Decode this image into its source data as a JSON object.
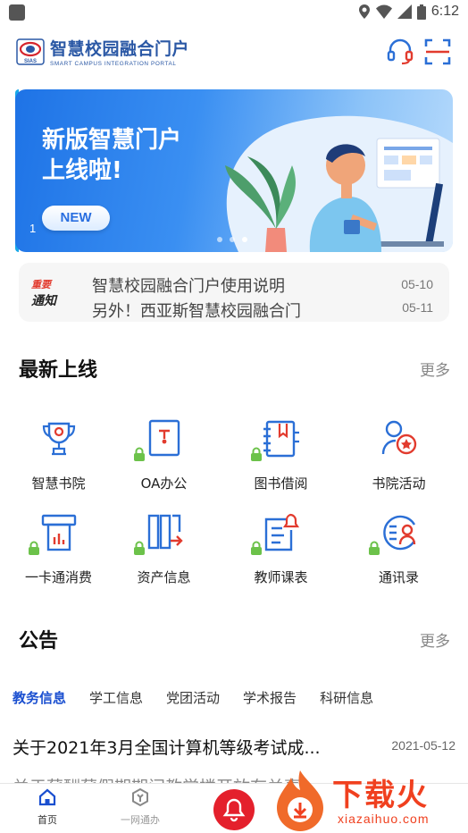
{
  "status_bar": {
    "time": "6:12"
  },
  "header": {
    "logo_badge_text": "SIAS",
    "title": "智慧校园融合门户",
    "subtitle": "SMART CAMPUS INTEGRATION PORTAL",
    "icons": [
      "headset-icon",
      "scan-icon"
    ]
  },
  "banner": {
    "title_line1": "新版智慧门户",
    "title_line2": "上线啦!",
    "badge": "NEW",
    "index": "1",
    "slide_count": 3,
    "active_slide": 3
  },
  "notice": {
    "tag_top": "重要",
    "tag_bottom": "通知",
    "items": [
      {
        "title": "智慧校园融合门户使用说明",
        "date": "05-10"
      },
      {
        "title": "另外！西亚斯智慧校园融合门",
        "date": "05-11"
      }
    ]
  },
  "latest": {
    "title": "最新上线",
    "more": "更多",
    "apps": [
      {
        "label": "智慧书院",
        "icon": "trophy-icon",
        "locked": false
      },
      {
        "label": "OA办公",
        "icon": "document-icon",
        "locked": true
      },
      {
        "label": "图书借阅",
        "icon": "book-icon",
        "locked": true
      },
      {
        "label": "书院活动",
        "icon": "activity-badge-icon",
        "locked": false
      },
      {
        "label": "一卡通消费",
        "icon": "card-icon",
        "locked": true
      },
      {
        "label": "资产信息",
        "icon": "asset-icon",
        "locked": true
      },
      {
        "label": "教师课表",
        "icon": "schedule-bell-icon",
        "locked": true
      },
      {
        "label": "通讯录",
        "icon": "contacts-icon",
        "locked": true
      }
    ]
  },
  "announcements": {
    "title": "公告",
    "more": "更多",
    "tabs": [
      "教务信息",
      "学工信息",
      "党团活动",
      "学术报告",
      "科研信息"
    ],
    "active_tab": 0,
    "items": [
      {
        "title": "关于2021年3月全国计算机等级考试成...",
        "date": "2021-05-12"
      },
      {
        "title": "关于薪酬薪假期期间教学楼开放有关事"
      }
    ]
  },
  "bottom_nav": {
    "items": [
      {
        "label": "首页",
        "icon": "home-icon"
      },
      {
        "label": "一网通办",
        "icon": "service-icon"
      },
      {
        "label": "",
        "icon": "bell-icon"
      }
    ]
  },
  "watermark": {
    "text": "下载火",
    "sub": "xiazaihuo.com"
  },
  "colors": {
    "accent": "#1a4fd0",
    "icon_blue": "#2b6fd6",
    "icon_red": "#e23b2e",
    "lock_green": "#6cc24a",
    "bell_red": "#e4202c"
  }
}
